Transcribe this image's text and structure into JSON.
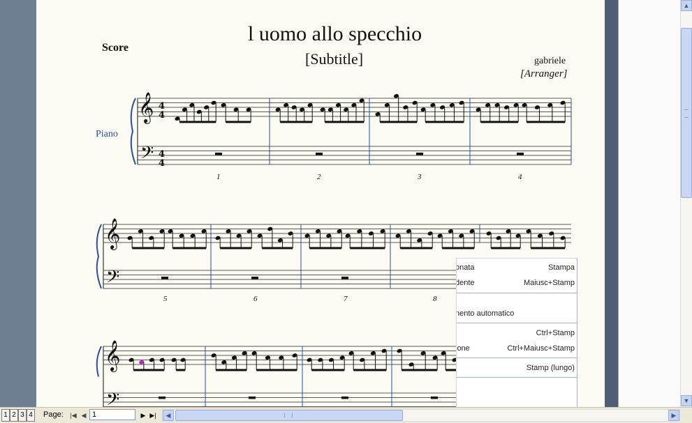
{
  "score": {
    "title": "l uomo allo specchio",
    "subtitle": "[Subtitle]",
    "score_label": "Score",
    "composer": "gabriele",
    "arranger": "[Arranger]",
    "instrument": "Piano",
    "time_signature_top": "4",
    "time_signature_bottom": "4",
    "measure_numbers": [
      "1",
      "2",
      "3",
      "4",
      "5",
      "6",
      "7",
      "8"
    ]
  },
  "context_menu": {
    "items": [
      {
        "label": "onata",
        "shortcut": "Stampa"
      },
      {
        "label": "dente",
        "shortcut": "Maiusc+Stamp"
      },
      {
        "label": "nento automatico",
        "shortcut": ""
      },
      {
        "label": "",
        "shortcut": "Ctrl+Stamp"
      },
      {
        "label": "ione",
        "shortcut": "Ctrl+Maiusc+Stamp"
      },
      {
        "label": "",
        "shortcut": "Stamp (lungo)"
      }
    ]
  },
  "bottom_bar": {
    "page_tabs": [
      "1",
      "2",
      "3",
      "4"
    ],
    "page_label": "Page:",
    "page_value": "1"
  },
  "colors": {
    "paper": "#fbfbf3",
    "background": "#6d7d92",
    "instrument_label": "#2e4f8c",
    "barline_blue": "#2a4f9e",
    "highlight_note": "#c020c0"
  },
  "icons": {
    "first_page": "first-page-icon",
    "prev_page": "prev-page-icon",
    "next_page": "next-page-icon",
    "last_page": "last-page-icon",
    "scroll_left": "scroll-left-icon",
    "scroll_right": "scroll-right-icon",
    "scroll_up": "scroll-up-icon",
    "scroll_down": "scroll-down-icon"
  }
}
